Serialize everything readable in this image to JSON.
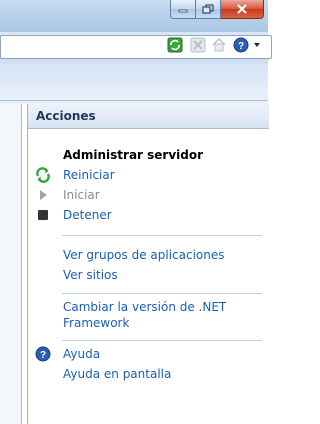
{
  "actions_pane": {
    "header": "Acciones",
    "section_title": "Administrar servidor",
    "items": [
      {
        "label": "Reiniciar",
        "icon": "restart-icon",
        "enabled": true
      },
      {
        "label": "Iniciar",
        "icon": "start-icon",
        "enabled": false
      },
      {
        "label": "Detener",
        "icon": "stop-icon",
        "enabled": true
      }
    ],
    "links": [
      {
        "label": "Ver grupos de aplicaciones"
      },
      {
        "label": "Ver sitios"
      },
      {
        "label": "Cambiar la versión de .NET"
      },
      {
        "label": "Framework"
      }
    ],
    "help": {
      "label": "Ayuda",
      "icon": "help-icon"
    },
    "online_help": {
      "label": "Ayuda en pantalla"
    }
  },
  "toolbar": {
    "icons": [
      "refresh-icon",
      "stop-icon",
      "home-icon",
      "help-icon"
    ]
  },
  "colors": {
    "link": "#1a5fb4",
    "disabled": "#8d8d8d",
    "header_text": "#1e395b",
    "close_button": "#c5391b"
  }
}
